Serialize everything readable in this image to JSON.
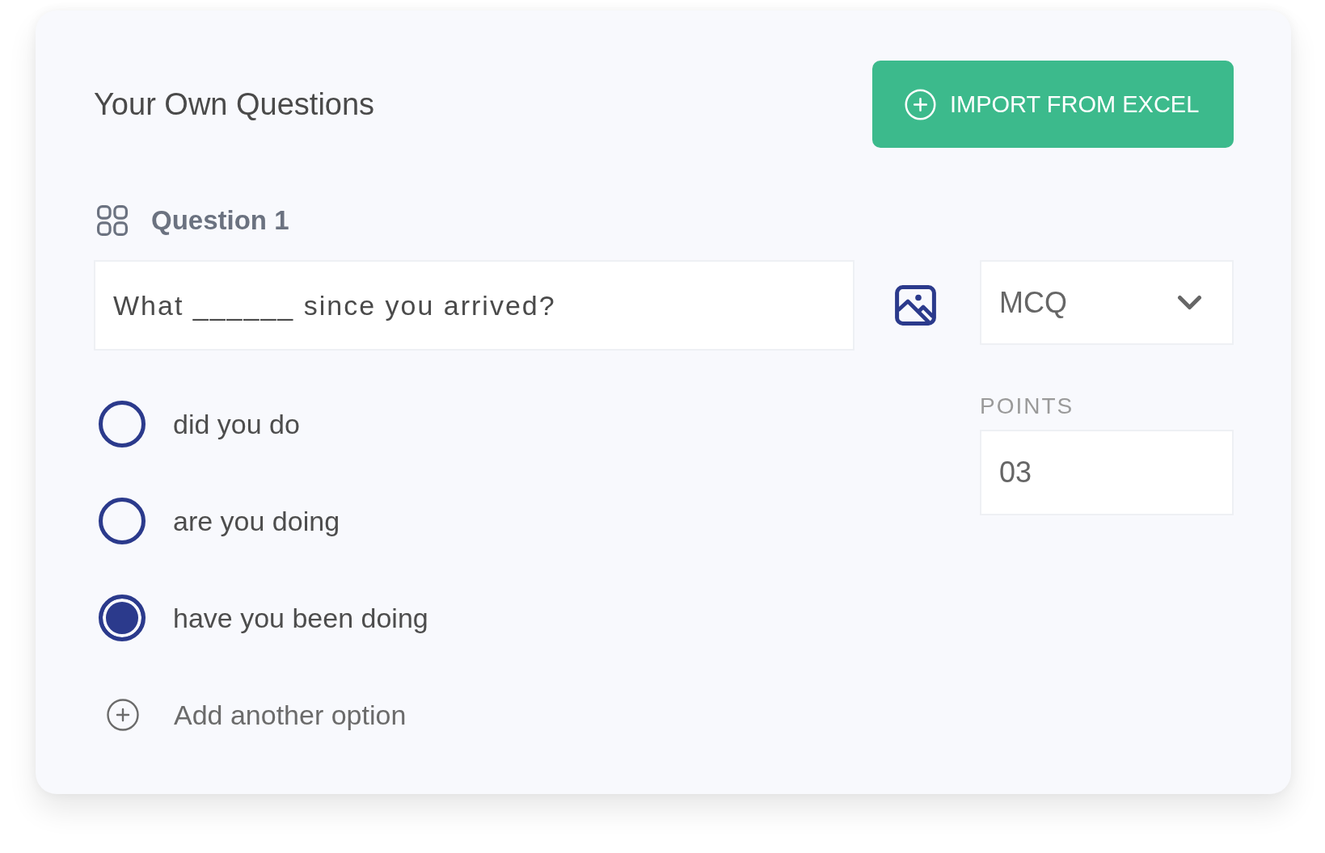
{
  "header": {
    "title": "Your Own Questions",
    "import_button": {
      "label": "IMPORT FROM EXCEL"
    }
  },
  "question": {
    "label": "Question 1",
    "text": "What ______ since you arrived?",
    "type": "MCQ",
    "points_label": "POINTS",
    "points": "03",
    "options": [
      {
        "label": "did you do",
        "selected": false
      },
      {
        "label": "are you doing",
        "selected": false
      },
      {
        "label": "have you been doing",
        "selected": true
      }
    ],
    "add_option": {
      "label": "Add another option"
    }
  }
}
